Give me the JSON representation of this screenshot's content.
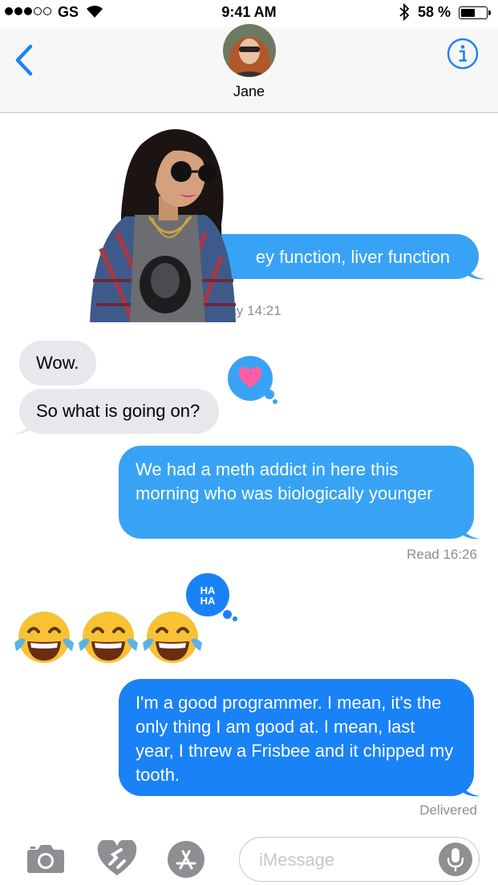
{
  "status_bar": {
    "carrier": "GS",
    "time": "9:41 AM",
    "battery_percent": "58 %",
    "battery_level": 0.58,
    "signal_bars": 3
  },
  "header": {
    "contact_name": "Jane"
  },
  "messages": [
    {
      "from": "me",
      "text": "ey function, liver function",
      "meta": "day 14:21"
    },
    {
      "from": "them",
      "text": "Wow.",
      "tapback": "heart"
    },
    {
      "from": "them",
      "text": "So what is going on?"
    },
    {
      "from": "me",
      "text": "We had a meth addict in here this morning who was biologically younger",
      "meta": "Read 16:26"
    },
    {
      "from": "them",
      "text": "😂😂😂",
      "tapback": "haha",
      "tapback_label": "HA HA"
    },
    {
      "from": "me",
      "text": "I'm a good programmer. I mean, it's the only thing I am good at. I mean, last year, I threw a Frisbee and it chipped my tooth.",
      "meta": "Delivered"
    }
  ],
  "input_bar": {
    "placeholder": "iMessage"
  },
  "colors": {
    "sms_blue": "#38a3f5",
    "imessage_blue": "#1a82f7",
    "received_gray": "#e7e7ec",
    "ios_blue": "#1a82f7",
    "heart_pink": "#ff5fa2"
  }
}
